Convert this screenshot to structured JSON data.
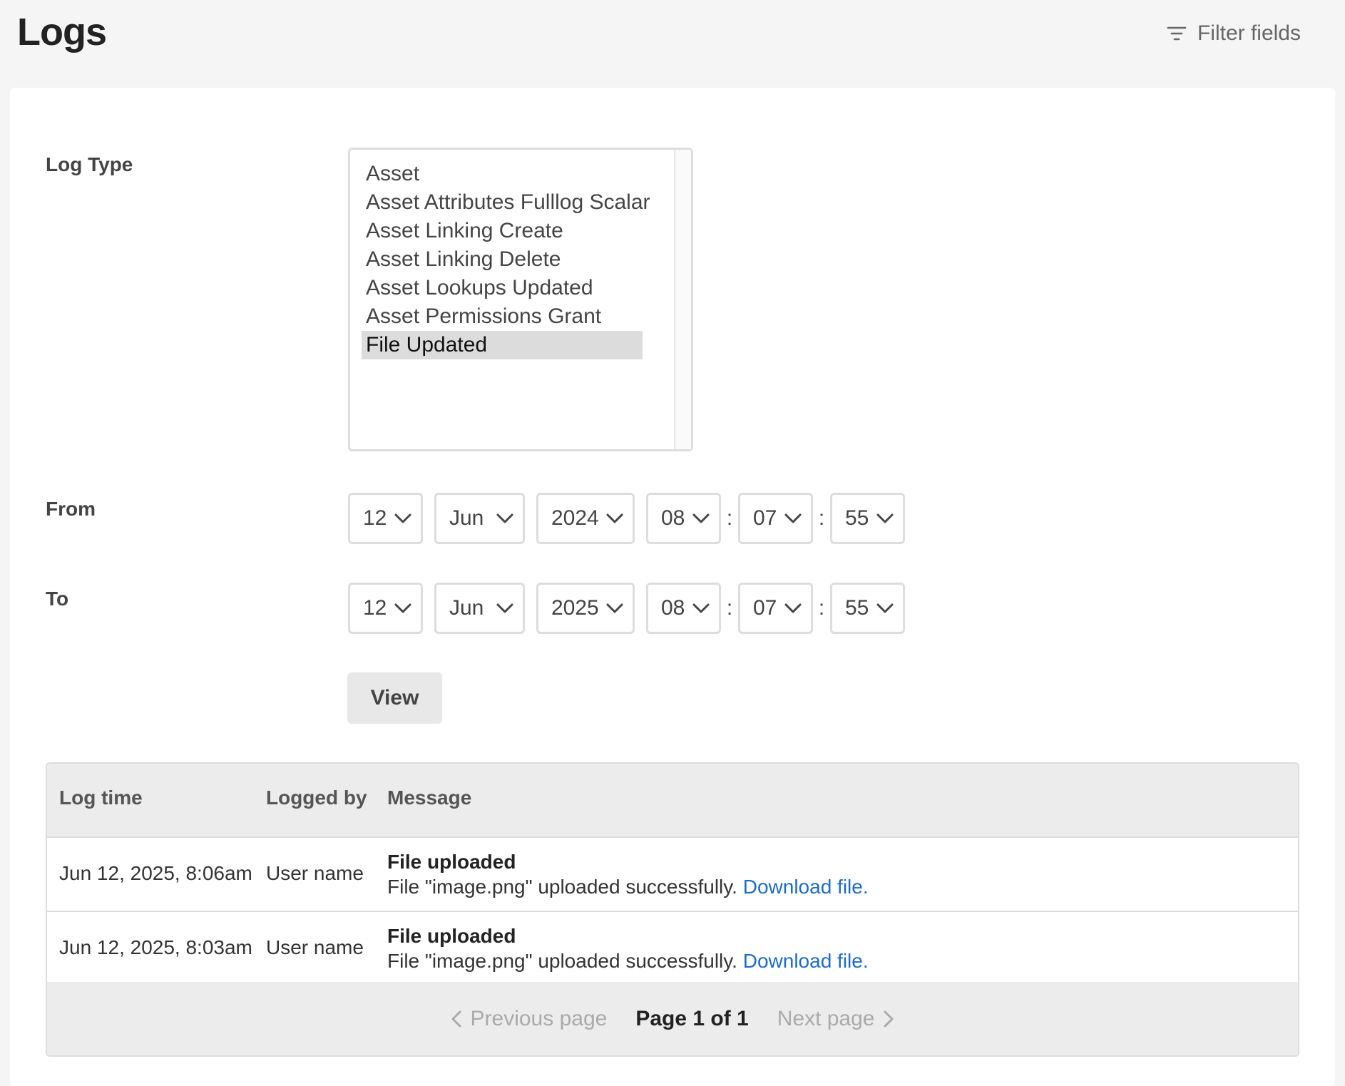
{
  "header": {
    "title": "Logs",
    "filter_label": "Filter fields"
  },
  "form": {
    "log_type_label": "Log Type",
    "log_types": [
      "Asset",
      "Asset Attributes Fulllog Scalar",
      "Asset Linking Create",
      "Asset Linking Delete",
      "Asset Lookups Updated",
      "Asset Permissions Grant",
      "File Updated"
    ],
    "selected_log_type": "File Updated",
    "from_label": "From",
    "from": {
      "day": "12",
      "month": "Jun",
      "year": "2024",
      "hour": "08",
      "minute": "07",
      "second": "55"
    },
    "to_label": "To",
    "to": {
      "day": "12",
      "month": "Jun",
      "year": "2025",
      "hour": "08",
      "minute": "07",
      "second": "55"
    },
    "time_separator": ":",
    "view_label": "View"
  },
  "table": {
    "columns": [
      "Log time",
      "Logged by",
      "Message"
    ],
    "rows": [
      {
        "time": "Jun 12, 2025, 8:06am",
        "by": "User name",
        "title": "File uploaded",
        "text": "File \"image.png\" uploaded successfully.",
        "link": "Download file."
      },
      {
        "time": "Jun 12, 2025, 8:03am",
        "by": "User name",
        "title": "File uploaded",
        "text": "File \"image.png\" uploaded successfully.",
        "link": "Download file."
      }
    ]
  },
  "pager": {
    "prev": "Previous page",
    "current": "Page 1 of 1",
    "next": "Next page"
  },
  "colors": {
    "link": "#1e6bc6",
    "selected_option": "#dcdcdc",
    "background": "#f5f5f5"
  }
}
